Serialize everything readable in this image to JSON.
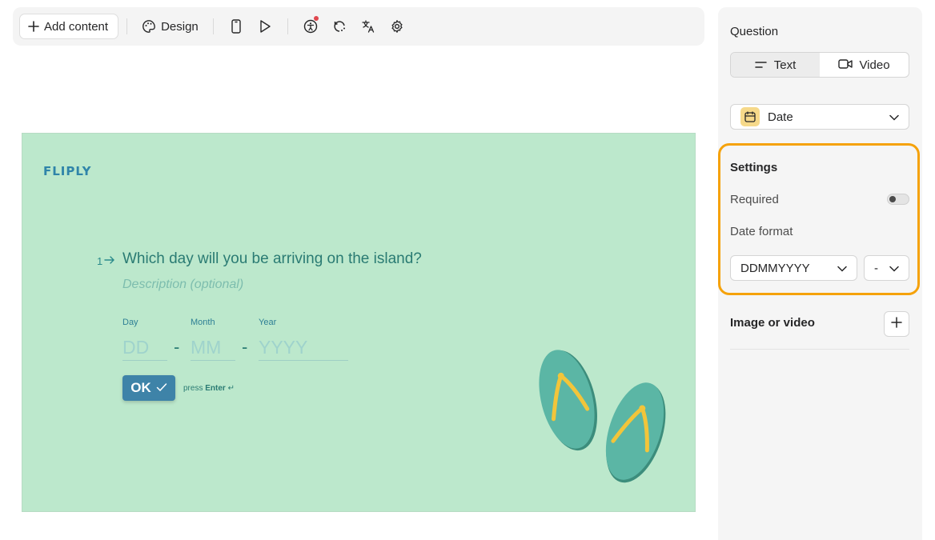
{
  "toolbar": {
    "add_content_label": "Add content",
    "design_label": "Design",
    "icons": [
      "plus-icon",
      "palette-icon",
      "mobile-icon",
      "play-icon",
      "accessibility-icon",
      "logic-icon",
      "translate-icon",
      "gear-icon"
    ]
  },
  "canvas": {
    "background": "#bce8cc",
    "logo_text": "FLIPLY",
    "question_number": "1",
    "question_title": "Which day will you be arriving on the island?",
    "description_placeholder": "Description (optional)",
    "fields": [
      {
        "label": "Day",
        "placeholder": "DD"
      },
      {
        "label": "Month",
        "placeholder": "MM"
      },
      {
        "label": "Year",
        "placeholder": "YYYY"
      }
    ],
    "separator": "-",
    "ok_label": "OK",
    "press_hint_prefix": "press",
    "press_hint_key": "Enter"
  },
  "panel": {
    "question_heading": "Question",
    "tabs": [
      {
        "label": "Text",
        "active": true
      },
      {
        "label": "Video",
        "active": false
      }
    ],
    "question_type": "Date",
    "settings_heading": "Settings",
    "required_label": "Required",
    "required_on": false,
    "date_format_label": "Date format",
    "date_format_value": "DDMMYYYY",
    "separator_value": "-",
    "media_label": "Image or video",
    "highlight_color": "#f5a20b"
  }
}
